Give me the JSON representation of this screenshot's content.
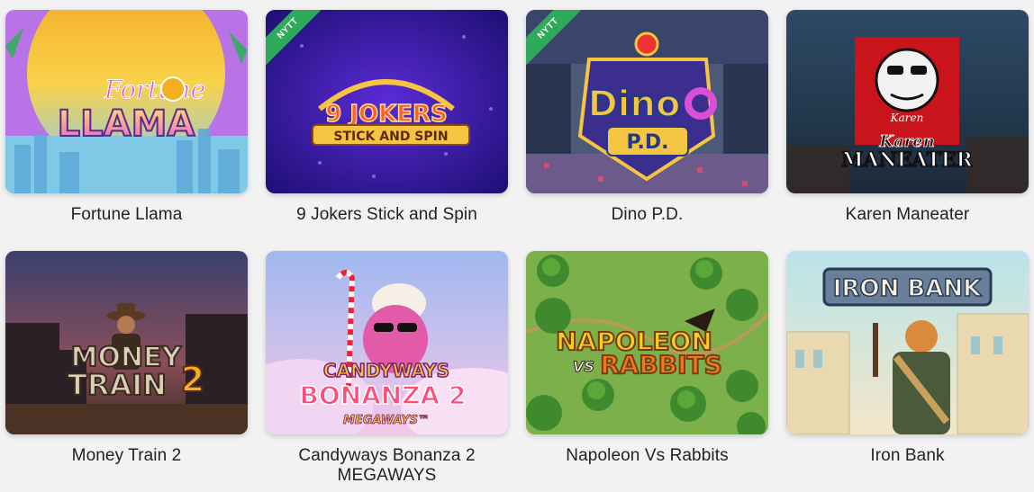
{
  "badge_label": "NYTT",
  "games": [
    {
      "title": "Fortune Llama",
      "logo": [
        "Fortune",
        "LLAMA"
      ],
      "is_new": false
    },
    {
      "title": "9 Jokers Stick and Spin",
      "logo": [
        "9 JOKERS",
        "STICK AND SPIN"
      ],
      "is_new": true
    },
    {
      "title": "Dino P.D.",
      "logo": [
        "Dino",
        "P.D."
      ],
      "is_new": true
    },
    {
      "title": "Karen Maneater",
      "logo": [
        "Karen",
        "Karen",
        "MANEATER"
      ],
      "is_new": false
    },
    {
      "title": "Money Train 2",
      "logo": [
        "MONEY",
        "TRAIN",
        "2"
      ],
      "is_new": false
    },
    {
      "title": "Candyways Bonanza 2",
      "title_overflow": "MEGAWAYS",
      "logo": [
        "CANDYWAYS",
        "BONANZA 2",
        "MEGAWAYS™"
      ],
      "is_new": false
    },
    {
      "title": "Napoleon Vs Rabbits",
      "logo": [
        "NAPOLEON",
        "VS",
        "RABBITS"
      ],
      "is_new": false
    },
    {
      "title": "Iron Bank",
      "logo": [
        "IRON BANK"
      ],
      "is_new": false
    }
  ]
}
